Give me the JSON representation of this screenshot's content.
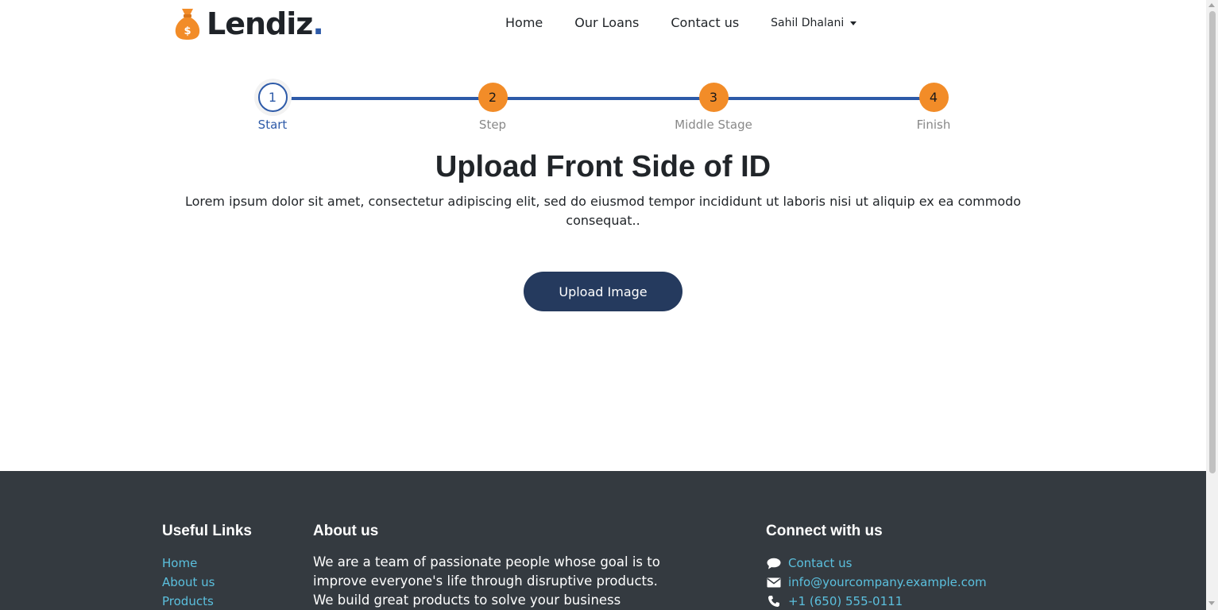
{
  "brand": {
    "name": "Lendiz",
    "dot": ".",
    "logo_icon": "money-bag-icon"
  },
  "nav": {
    "links": [
      "Home",
      "Our Loans",
      "Contact us"
    ],
    "user": "Sahil Dhalani"
  },
  "stepper": {
    "steps": [
      {
        "number": "1",
        "label": "Start",
        "state": "active"
      },
      {
        "number": "2",
        "label": "Step",
        "state": "pending"
      },
      {
        "number": "3",
        "label": "Middle Stage",
        "state": "pending"
      },
      {
        "number": "4",
        "label": "Finish",
        "state": "pending"
      }
    ]
  },
  "main": {
    "title": "Upload Front Side of ID",
    "description": "Lorem ipsum dolor sit amet, consectetur adipiscing elit, sed do eiusmod tempor incididunt ut laboris nisi ut aliquip ex ea commodo consequat..",
    "upload_label": "Upload Image"
  },
  "footer": {
    "useful_links": {
      "heading": "Useful Links",
      "links": [
        "Home",
        "About us",
        "Products"
      ]
    },
    "about": {
      "heading": "About us",
      "text": "We are a team of passionate people whose goal is to improve everyone's life through disruptive products. We build great products to solve your business"
    },
    "connect": {
      "heading": "Connect with us",
      "items": [
        {
          "icon": "chat-bubble-icon",
          "text": "Contact us"
        },
        {
          "icon": "envelope-icon",
          "text": "info@yourcompany.example.com"
        },
        {
          "icon": "phone-icon",
          "text": "+1 (650) 555-0111"
        }
      ]
    }
  },
  "colors": {
    "primary": "#2d5aa8",
    "accent": "#f28c28",
    "button": "#253a5e",
    "footer_bg": "#343a40",
    "link": "#5bc0de"
  }
}
